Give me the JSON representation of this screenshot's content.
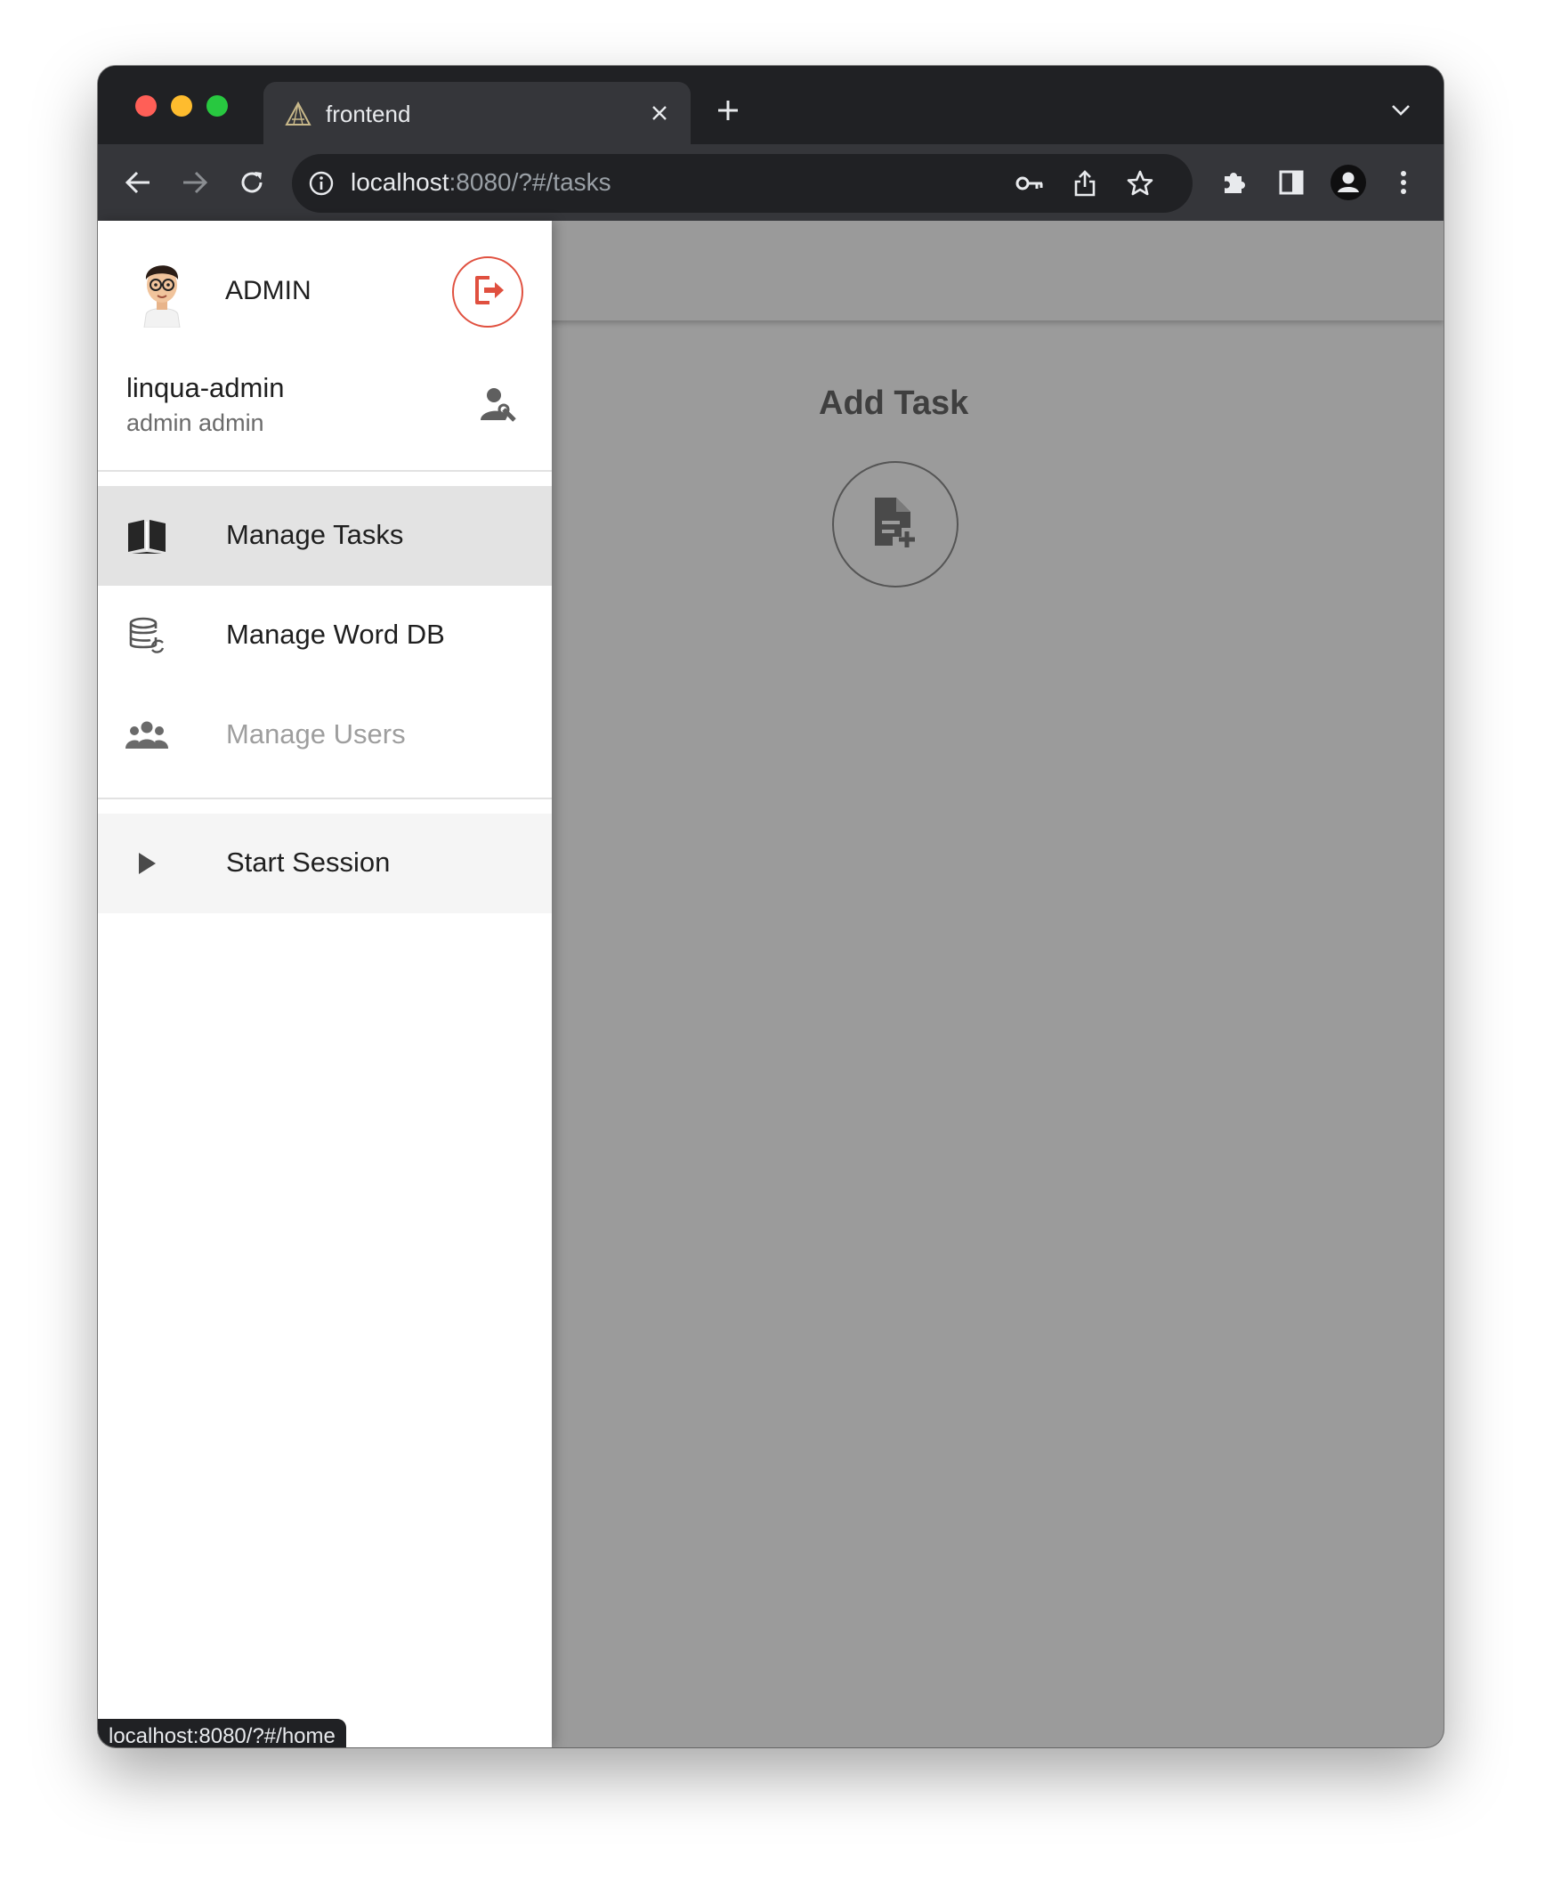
{
  "browser": {
    "tab": {
      "title": "frontend",
      "favicon": "triangle-logo-icon",
      "close_icon": "close-icon"
    },
    "new_tab_icon": "plus-icon",
    "tab_list_icon": "chevron-down-icon",
    "nav": {
      "back_icon": "arrow-left-icon",
      "forward_icon": "arrow-right-icon",
      "reload_icon": "reload-icon"
    },
    "omnibox": {
      "url_host": "localhost",
      "url_rest": ":8080/?#/tasks",
      "icons": [
        "info-icon",
        "key-icon",
        "share-icon",
        "star-icon"
      ]
    },
    "toolbar_icons": [
      "puzzle-icon",
      "side-panel-icon",
      "profile-icon",
      "kebab-menu-icon"
    ],
    "status_url": "localhost:8080/?#/home"
  },
  "drawer": {
    "role": "ADMIN",
    "username": "linqua-admin",
    "full_name": "admin admin",
    "logout_icon": "logout-icon",
    "manage_user_icon": "user-wrench-icon",
    "items": [
      {
        "label": "Manage Tasks",
        "icon": "book-icon",
        "active": true,
        "enabled": true
      },
      {
        "label": "Manage Word DB",
        "icon": "database-sync-icon",
        "active": false,
        "enabled": true
      },
      {
        "label": "Manage Users",
        "icon": "users-icon",
        "active": false,
        "enabled": false
      }
    ],
    "session_item": {
      "label": "Start Session",
      "icon": "play-icon"
    }
  },
  "main": {
    "add_task_title": "Add Task",
    "add_task_icon": "note-add-icon"
  },
  "colors": {
    "accent_red": "#e0503f",
    "scrim_gray": "#9b9b9b",
    "chrome_dark": "#202124",
    "chrome_mid": "#35363a"
  }
}
